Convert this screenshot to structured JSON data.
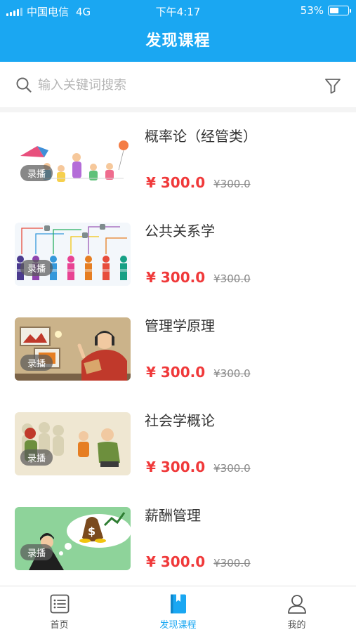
{
  "status_bar": {
    "carrier": "中国电信",
    "network": "4G",
    "time": "下午4:17",
    "battery": "53%",
    "battery_level": 0.53
  },
  "header": {
    "title": "发现课程"
  },
  "search": {
    "placeholder": "输入关键词搜索",
    "value": ""
  },
  "courses": [
    {
      "title": "概率论（经管类）",
      "price": "¥ 300.0",
      "original_price": "¥300.0",
      "badge": "录播"
    },
    {
      "title": "公共关系学",
      "price": "¥ 300.0",
      "original_price": "¥300.0",
      "badge": "录播"
    },
    {
      "title": "管理学原理",
      "price": "¥ 300.0",
      "original_price": "¥300.0",
      "badge": "录播"
    },
    {
      "title": "社会学概论",
      "price": "¥ 300.0",
      "original_price": "¥300.0",
      "badge": "录播"
    },
    {
      "title": "薪酬管理",
      "price": "¥ 300.0",
      "original_price": "¥300.0",
      "badge": "录播"
    }
  ],
  "tabs": [
    {
      "label": "首页",
      "icon": "list-icon",
      "active": false
    },
    {
      "label": "发现课程",
      "icon": "book-icon",
      "active": true
    },
    {
      "label": "我的",
      "icon": "person-icon",
      "active": false
    }
  ],
  "colors": {
    "primary": "#1aa7f2",
    "price": "#f0393a"
  }
}
